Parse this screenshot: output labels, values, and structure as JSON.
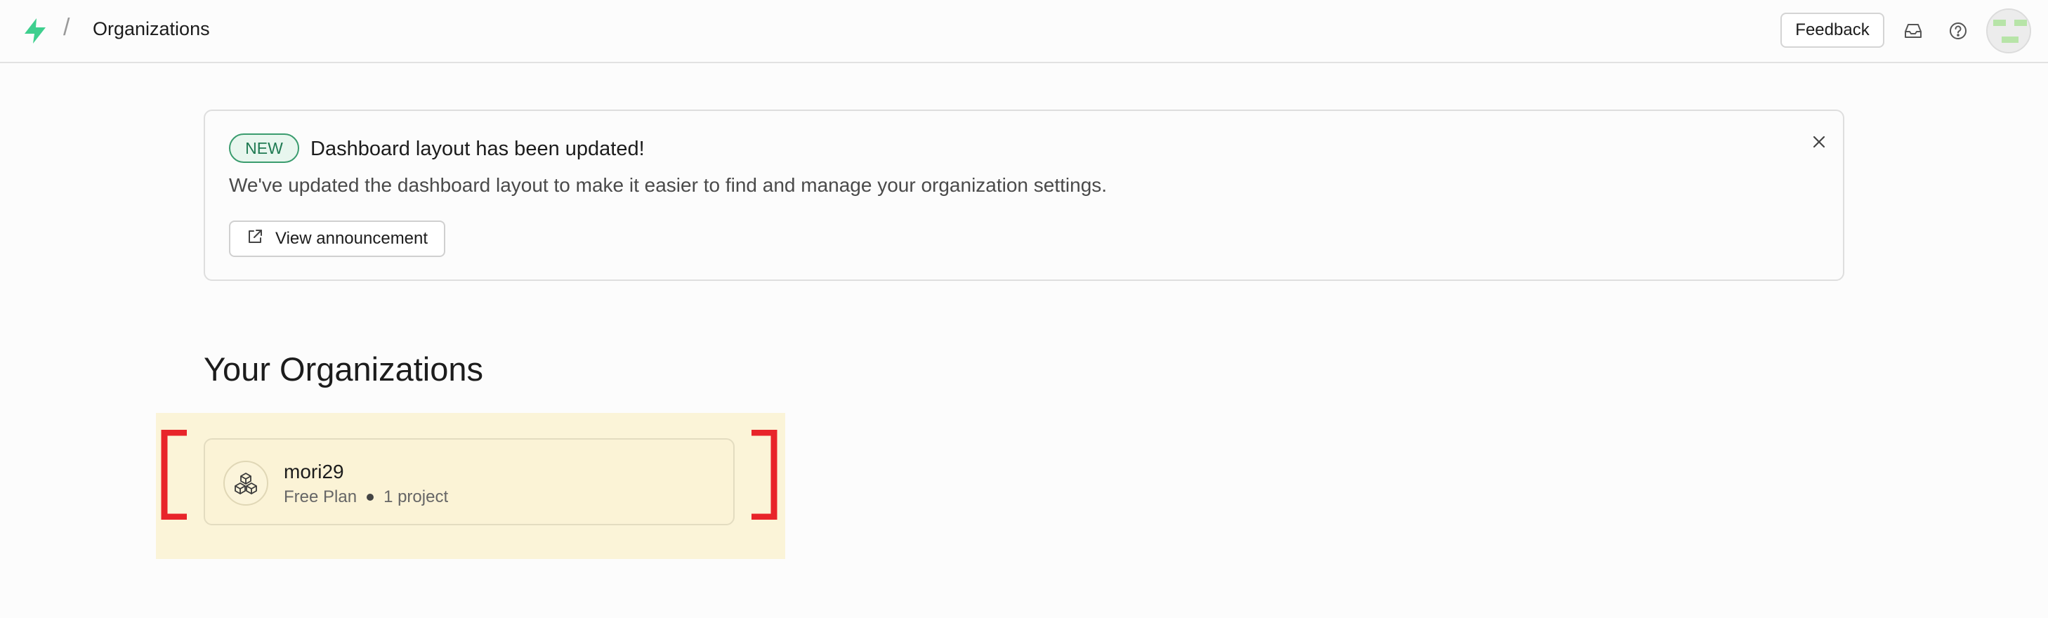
{
  "header": {
    "breadcrumb_separator": "/",
    "title": "Organizations",
    "feedback_label": "Feedback",
    "brand_color": "#3ecf8e"
  },
  "announcement": {
    "badge": "NEW",
    "title": "Dashboard layout has been updated!",
    "description": "We've updated the dashboard layout to make it easier to find and manage your organization settings.",
    "button_label": "View announcement",
    "badge_color": "#1f7a52"
  },
  "organizations": {
    "title": "Your Organizations",
    "items": [
      {
        "name": "mori29",
        "plan": "Free Plan",
        "projects": "1 project"
      }
    ],
    "highlight_color": "#e8242a"
  },
  "icons": {
    "logo": "supabase-logo-icon",
    "inbox": "inbox-icon",
    "help": "help-circle-icon",
    "close": "close-icon",
    "external": "external-link-icon",
    "org": "boxes-icon"
  }
}
